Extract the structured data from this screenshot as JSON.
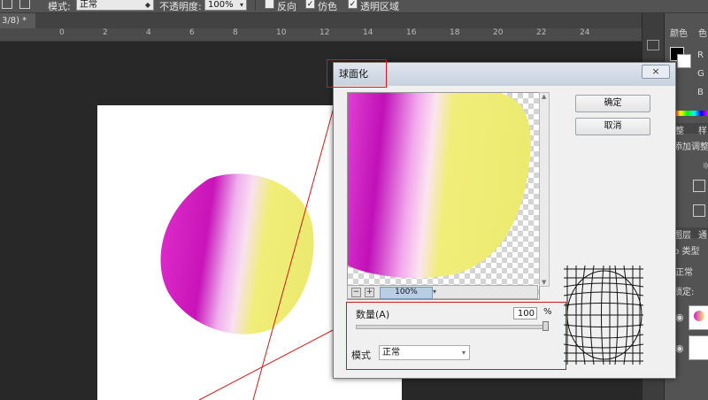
{
  "options_bar": {
    "mode_label": "模式:",
    "mode_value": "正常",
    "opacity_label": "不透明度:",
    "opacity_value": "100%",
    "reverse_label": "反向",
    "dither_label": "仿色",
    "transparency_label": "透明区域",
    "reverse_checked": false,
    "dither_checked": true,
    "transparency_checked": true
  },
  "document_tab": {
    "label": "3/8) *",
    "close": "×"
  },
  "ruler": {
    "numbers": [
      "0",
      "2",
      "4",
      "6",
      "8",
      "10",
      "12",
      "14",
      "16",
      "18",
      "20",
      "22",
      "24"
    ]
  },
  "right_panel": {
    "color_tab": "颜色",
    "swatch_tab": "色",
    "r_label": "R",
    "g_label": "G",
    "b_label": "B",
    "adjust_tab_1": "整",
    "adjust_tab_2": "样",
    "adjust_label": "添加调整",
    "layers_tab": "图层",
    "channels_tab": "通",
    "kind_label": "ρ 类型",
    "blend_mode": "正常",
    "lock_label": "锁定:"
  },
  "dialog": {
    "title": "球面化",
    "close": "×",
    "ok_label": "确定",
    "cancel_label": "取消",
    "zoom_out": "−",
    "zoom_in": "+",
    "zoom_value": "100%",
    "amount_label": "数量(A)",
    "amount_value": "100",
    "amount_unit": "%",
    "amount_fraction": 1.0,
    "mode_label": "模式",
    "mode_value": "正常"
  },
  "colors": {
    "magenta": "#e020c8",
    "yellow": "#f0ee78",
    "annotation_red": "#d01818",
    "panel_gray": "#535353"
  },
  "icons": [
    "close-icon",
    "dropdown-arrow-icon",
    "zoom-in-icon",
    "zoom-out-icon",
    "spherize-grid-icon",
    "checkbox-icon",
    "eye-icon"
  ]
}
